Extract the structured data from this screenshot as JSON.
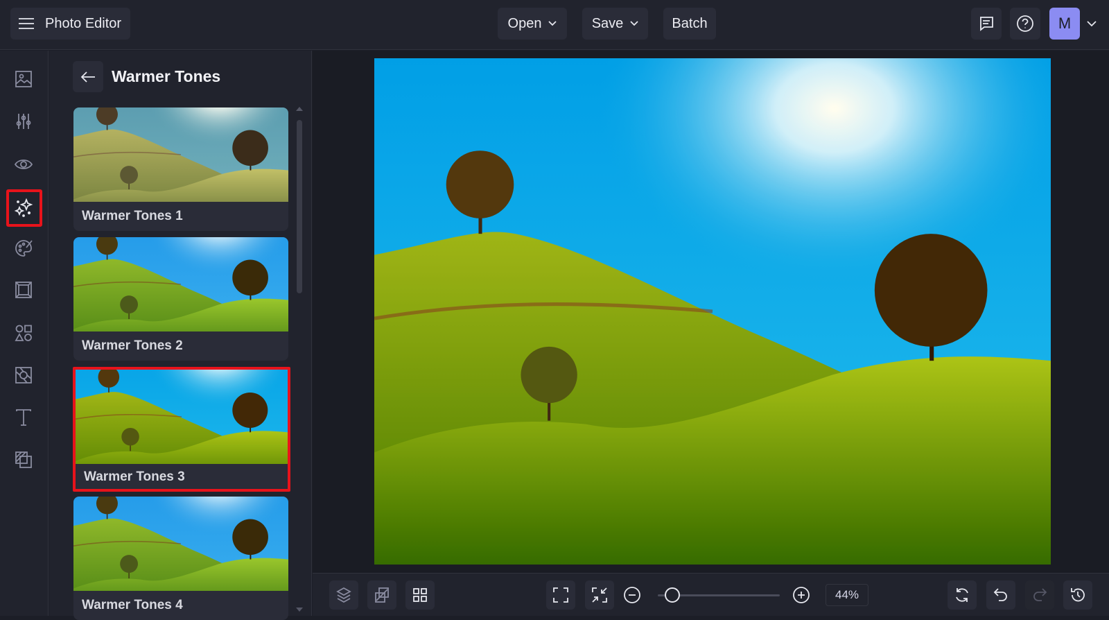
{
  "header": {
    "title": "Photo Editor",
    "open_label": "Open",
    "save_label": "Save",
    "batch_label": "Batch",
    "avatar_initial": "M"
  },
  "panel": {
    "title": "Warmer Tones",
    "items": [
      {
        "label": "Warmer Tones 1"
      },
      {
        "label": "Warmer Tones 2"
      },
      {
        "label": "Warmer Tones 3",
        "selected": true
      },
      {
        "label": "Warmer Tones 4"
      }
    ]
  },
  "rail": {
    "items": [
      "image-icon",
      "adjust-icon",
      "eye-icon",
      "effects-icon",
      "artsy-icon",
      "frame-icon",
      "graphics-icon",
      "overlay-icon",
      "text-icon",
      "collage-icon"
    ],
    "selected": "effects-icon"
  },
  "zoom": {
    "value": "44%",
    "level": 0.12
  },
  "colors": {
    "accent_selected": "#e8131b",
    "avatar_bg": "#8b8cf2"
  }
}
